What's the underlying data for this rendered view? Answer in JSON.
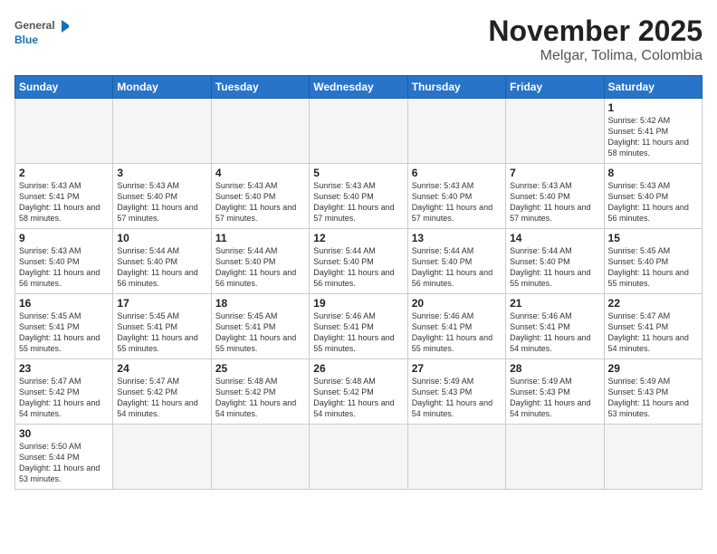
{
  "header": {
    "logo_general": "General",
    "logo_blue": "Blue",
    "month_year": "November 2025",
    "location": "Melgar, Tolima, Colombia"
  },
  "days_of_week": [
    "Sunday",
    "Monday",
    "Tuesday",
    "Wednesday",
    "Thursday",
    "Friday",
    "Saturday"
  ],
  "weeks": [
    [
      {
        "day": "",
        "empty": true
      },
      {
        "day": "",
        "empty": true
      },
      {
        "day": "",
        "empty": true
      },
      {
        "day": "",
        "empty": true
      },
      {
        "day": "",
        "empty": true
      },
      {
        "day": "",
        "empty": true
      },
      {
        "day": "1",
        "sunrise": "5:42 AM",
        "sunset": "5:41 PM",
        "daylight": "11 hours and 58 minutes."
      }
    ],
    [
      {
        "day": "2",
        "sunrise": "5:43 AM",
        "sunset": "5:41 PM",
        "daylight": "11 hours and 58 minutes."
      },
      {
        "day": "3",
        "sunrise": "5:43 AM",
        "sunset": "5:40 PM",
        "daylight": "11 hours and 57 minutes."
      },
      {
        "day": "4",
        "sunrise": "5:43 AM",
        "sunset": "5:40 PM",
        "daylight": "11 hours and 57 minutes."
      },
      {
        "day": "5",
        "sunrise": "5:43 AM",
        "sunset": "5:40 PM",
        "daylight": "11 hours and 57 minutes."
      },
      {
        "day": "6",
        "sunrise": "5:43 AM",
        "sunset": "5:40 PM",
        "daylight": "11 hours and 57 minutes."
      },
      {
        "day": "7",
        "sunrise": "5:43 AM",
        "sunset": "5:40 PM",
        "daylight": "11 hours and 57 minutes."
      },
      {
        "day": "8",
        "sunrise": "5:43 AM",
        "sunset": "5:40 PM",
        "daylight": "11 hours and 56 minutes."
      }
    ],
    [
      {
        "day": "9",
        "sunrise": "5:43 AM",
        "sunset": "5:40 PM",
        "daylight": "11 hours and 56 minutes."
      },
      {
        "day": "10",
        "sunrise": "5:44 AM",
        "sunset": "5:40 PM",
        "daylight": "11 hours and 56 minutes."
      },
      {
        "day": "11",
        "sunrise": "5:44 AM",
        "sunset": "5:40 PM",
        "daylight": "11 hours and 56 minutes."
      },
      {
        "day": "12",
        "sunrise": "5:44 AM",
        "sunset": "5:40 PM",
        "daylight": "11 hours and 56 minutes."
      },
      {
        "day": "13",
        "sunrise": "5:44 AM",
        "sunset": "5:40 PM",
        "daylight": "11 hours and 56 minutes."
      },
      {
        "day": "14",
        "sunrise": "5:44 AM",
        "sunset": "5:40 PM",
        "daylight": "11 hours and 55 minutes."
      },
      {
        "day": "15",
        "sunrise": "5:45 AM",
        "sunset": "5:40 PM",
        "daylight": "11 hours and 55 minutes."
      }
    ],
    [
      {
        "day": "16",
        "sunrise": "5:45 AM",
        "sunset": "5:41 PM",
        "daylight": "11 hours and 55 minutes."
      },
      {
        "day": "17",
        "sunrise": "5:45 AM",
        "sunset": "5:41 PM",
        "daylight": "11 hours and 55 minutes."
      },
      {
        "day": "18",
        "sunrise": "5:45 AM",
        "sunset": "5:41 PM",
        "daylight": "11 hours and 55 minutes."
      },
      {
        "day": "19",
        "sunrise": "5:46 AM",
        "sunset": "5:41 PM",
        "daylight": "11 hours and 55 minutes."
      },
      {
        "day": "20",
        "sunrise": "5:46 AM",
        "sunset": "5:41 PM",
        "daylight": "11 hours and 55 minutes."
      },
      {
        "day": "21",
        "sunrise": "5:46 AM",
        "sunset": "5:41 PM",
        "daylight": "11 hours and 54 minutes."
      },
      {
        "day": "22",
        "sunrise": "5:47 AM",
        "sunset": "5:41 PM",
        "daylight": "11 hours and 54 minutes."
      }
    ],
    [
      {
        "day": "23",
        "sunrise": "5:47 AM",
        "sunset": "5:42 PM",
        "daylight": "11 hours and 54 minutes."
      },
      {
        "day": "24",
        "sunrise": "5:47 AM",
        "sunset": "5:42 PM",
        "daylight": "11 hours and 54 minutes."
      },
      {
        "day": "25",
        "sunrise": "5:48 AM",
        "sunset": "5:42 PM",
        "daylight": "11 hours and 54 minutes."
      },
      {
        "day": "26",
        "sunrise": "5:48 AM",
        "sunset": "5:42 PM",
        "daylight": "11 hours and 54 minutes."
      },
      {
        "day": "27",
        "sunrise": "5:49 AM",
        "sunset": "5:43 PM",
        "daylight": "11 hours and 54 minutes."
      },
      {
        "day": "28",
        "sunrise": "5:49 AM",
        "sunset": "5:43 PM",
        "daylight": "11 hours and 54 minutes."
      },
      {
        "day": "29",
        "sunrise": "5:49 AM",
        "sunset": "5:43 PM",
        "daylight": "11 hours and 53 minutes."
      }
    ],
    [
      {
        "day": "30",
        "sunrise": "5:50 AM",
        "sunset": "5:44 PM",
        "daylight": "11 hours and 53 minutes."
      },
      {
        "day": "",
        "empty": true
      },
      {
        "day": "",
        "empty": true
      },
      {
        "day": "",
        "empty": true
      },
      {
        "day": "",
        "empty": true
      },
      {
        "day": "",
        "empty": true
      },
      {
        "day": "",
        "empty": true
      }
    ]
  ],
  "labels": {
    "sunrise_prefix": "Sunrise: ",
    "sunset_prefix": "Sunset: ",
    "daylight_prefix": "Daylight: "
  }
}
